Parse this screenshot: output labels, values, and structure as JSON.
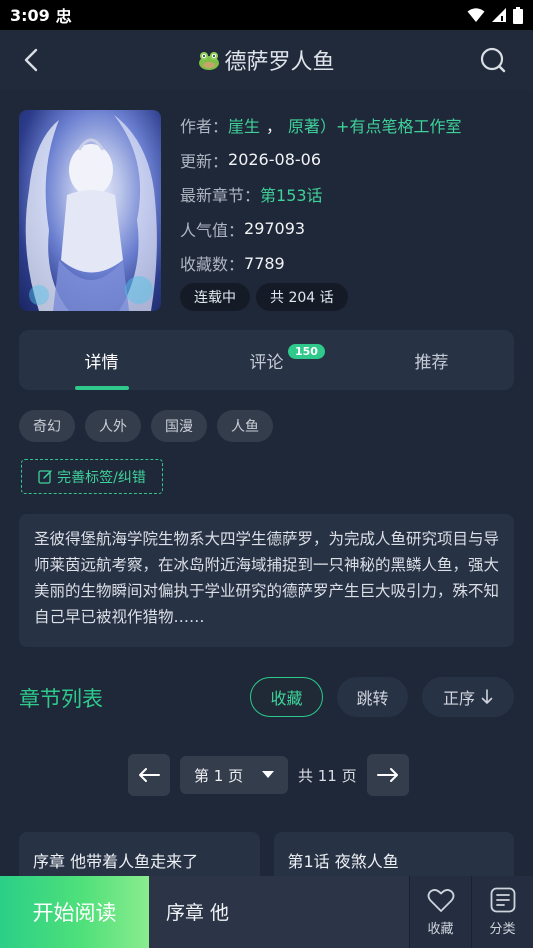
{
  "status_bar": {
    "time": "3:09",
    "carrier": "忠"
  },
  "header": {
    "title": "德萨罗人鱼"
  },
  "book": {
    "author_label": "作者：",
    "author_a": "崖生",
    "author_sep": "，",
    "author_b": "原著）+有点笔格工作室",
    "update_label": "更新：",
    "update_value": "2026-08-06",
    "latest_label": "最新章节：",
    "latest_value": "第153话",
    "popularity_label": "人气值：",
    "popularity_value": "297093",
    "favorites_label": "收藏数：",
    "favorites_value": "7789",
    "status_chip": "连载中",
    "count_chip": "共 204 话"
  },
  "tabs": [
    {
      "label": "详情",
      "active": true
    },
    {
      "label": "评论",
      "badge": "150"
    },
    {
      "label": "推荐"
    }
  ],
  "tags": [
    "奇幻",
    "人外",
    "国漫",
    "人鱼"
  ],
  "improve_tags_label": "完善标签/纠错",
  "description": "圣彼得堡航海学院生物系大四学生德萨罗，为完成人鱼研究项目与导师莱茵远航考察，在冰岛附近海域捕捉到一只神秘的黑鳞人鱼，强大美丽的生物瞬间对偏执于学业研究的德萨罗产生巨大吸引力，殊不知自己早已被视作猎物……",
  "chapter_section": {
    "title": "章节列表",
    "collect_label": "收藏",
    "jump_label": "跳转",
    "order_label": "正序"
  },
  "pagination": {
    "current_page": "第 1 页",
    "total": "共 11 页"
  },
  "chapters": [
    "序章 他带着人鱼走来了",
    "第1话 夜煞人鱼"
  ],
  "bottom_bar": {
    "start_label": "开始阅读",
    "current_chapter": "序章 他",
    "favorite_label": "收藏",
    "category_label": "分类"
  },
  "colors": {
    "accent": "#2ec98b",
    "background": "#1f2838",
    "card": "#283245"
  }
}
